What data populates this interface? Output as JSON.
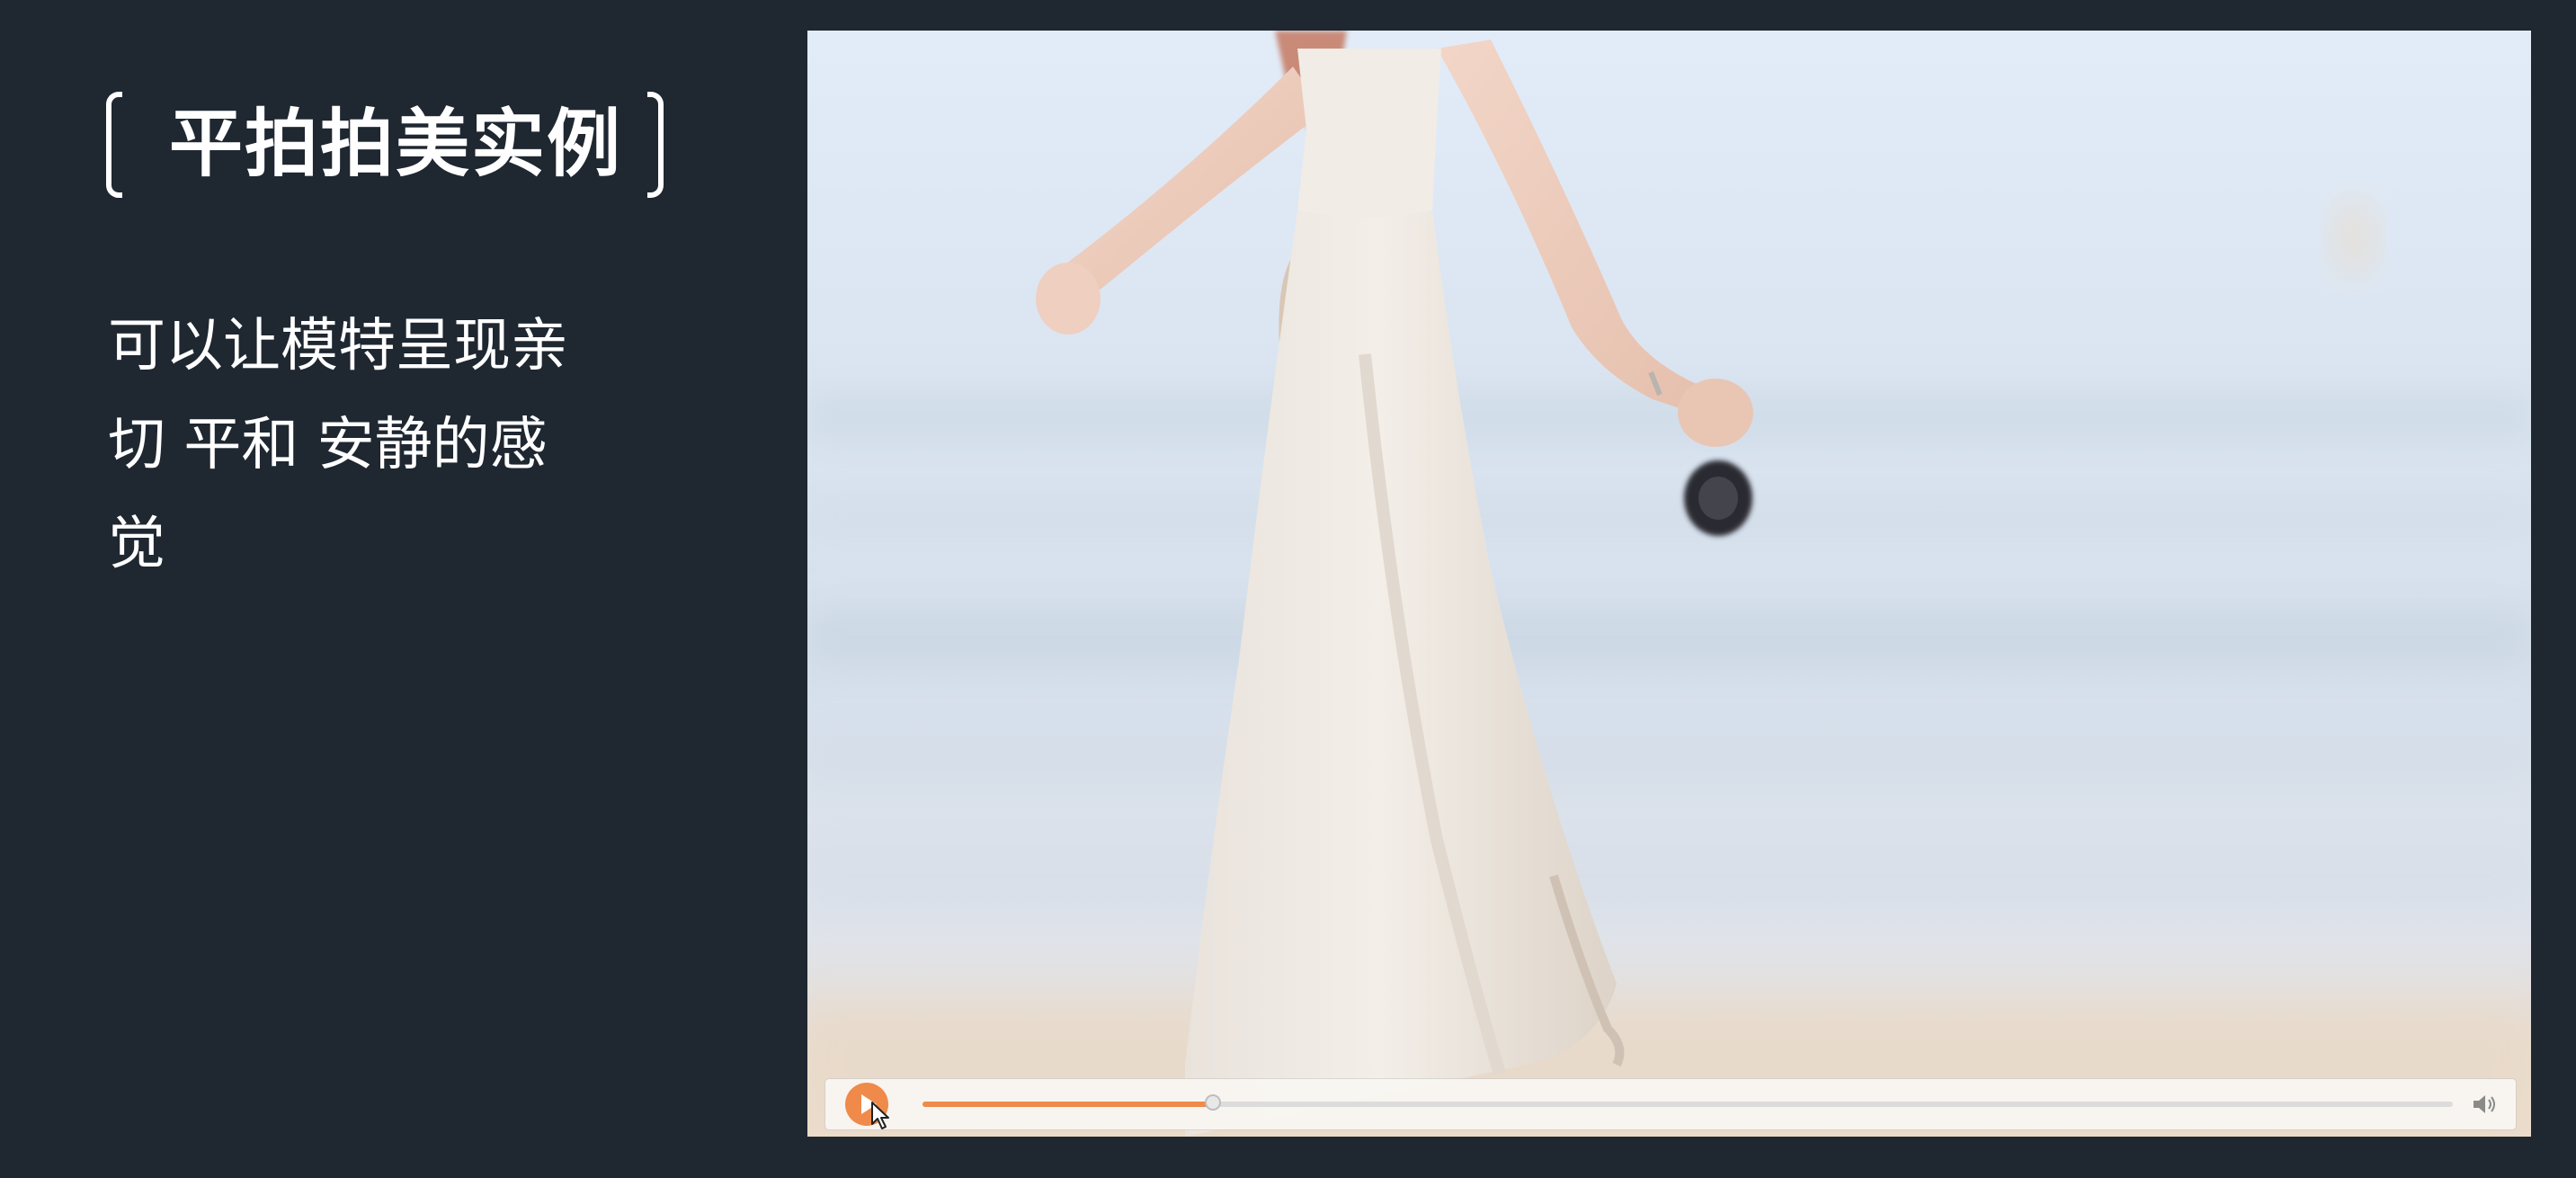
{
  "slide": {
    "title": "平拍拍美实例",
    "description_lines": [
      "可以让模特呈现亲",
      "切 平和 安静的感",
      "觉"
    ]
  },
  "player": {
    "progress": 0.19,
    "play_icon": "play-icon",
    "volume_icon": "volume-icon",
    "accent_color": "#ef8a4a"
  },
  "colors": {
    "background": "#1f2731",
    "text": "#ffffff"
  }
}
